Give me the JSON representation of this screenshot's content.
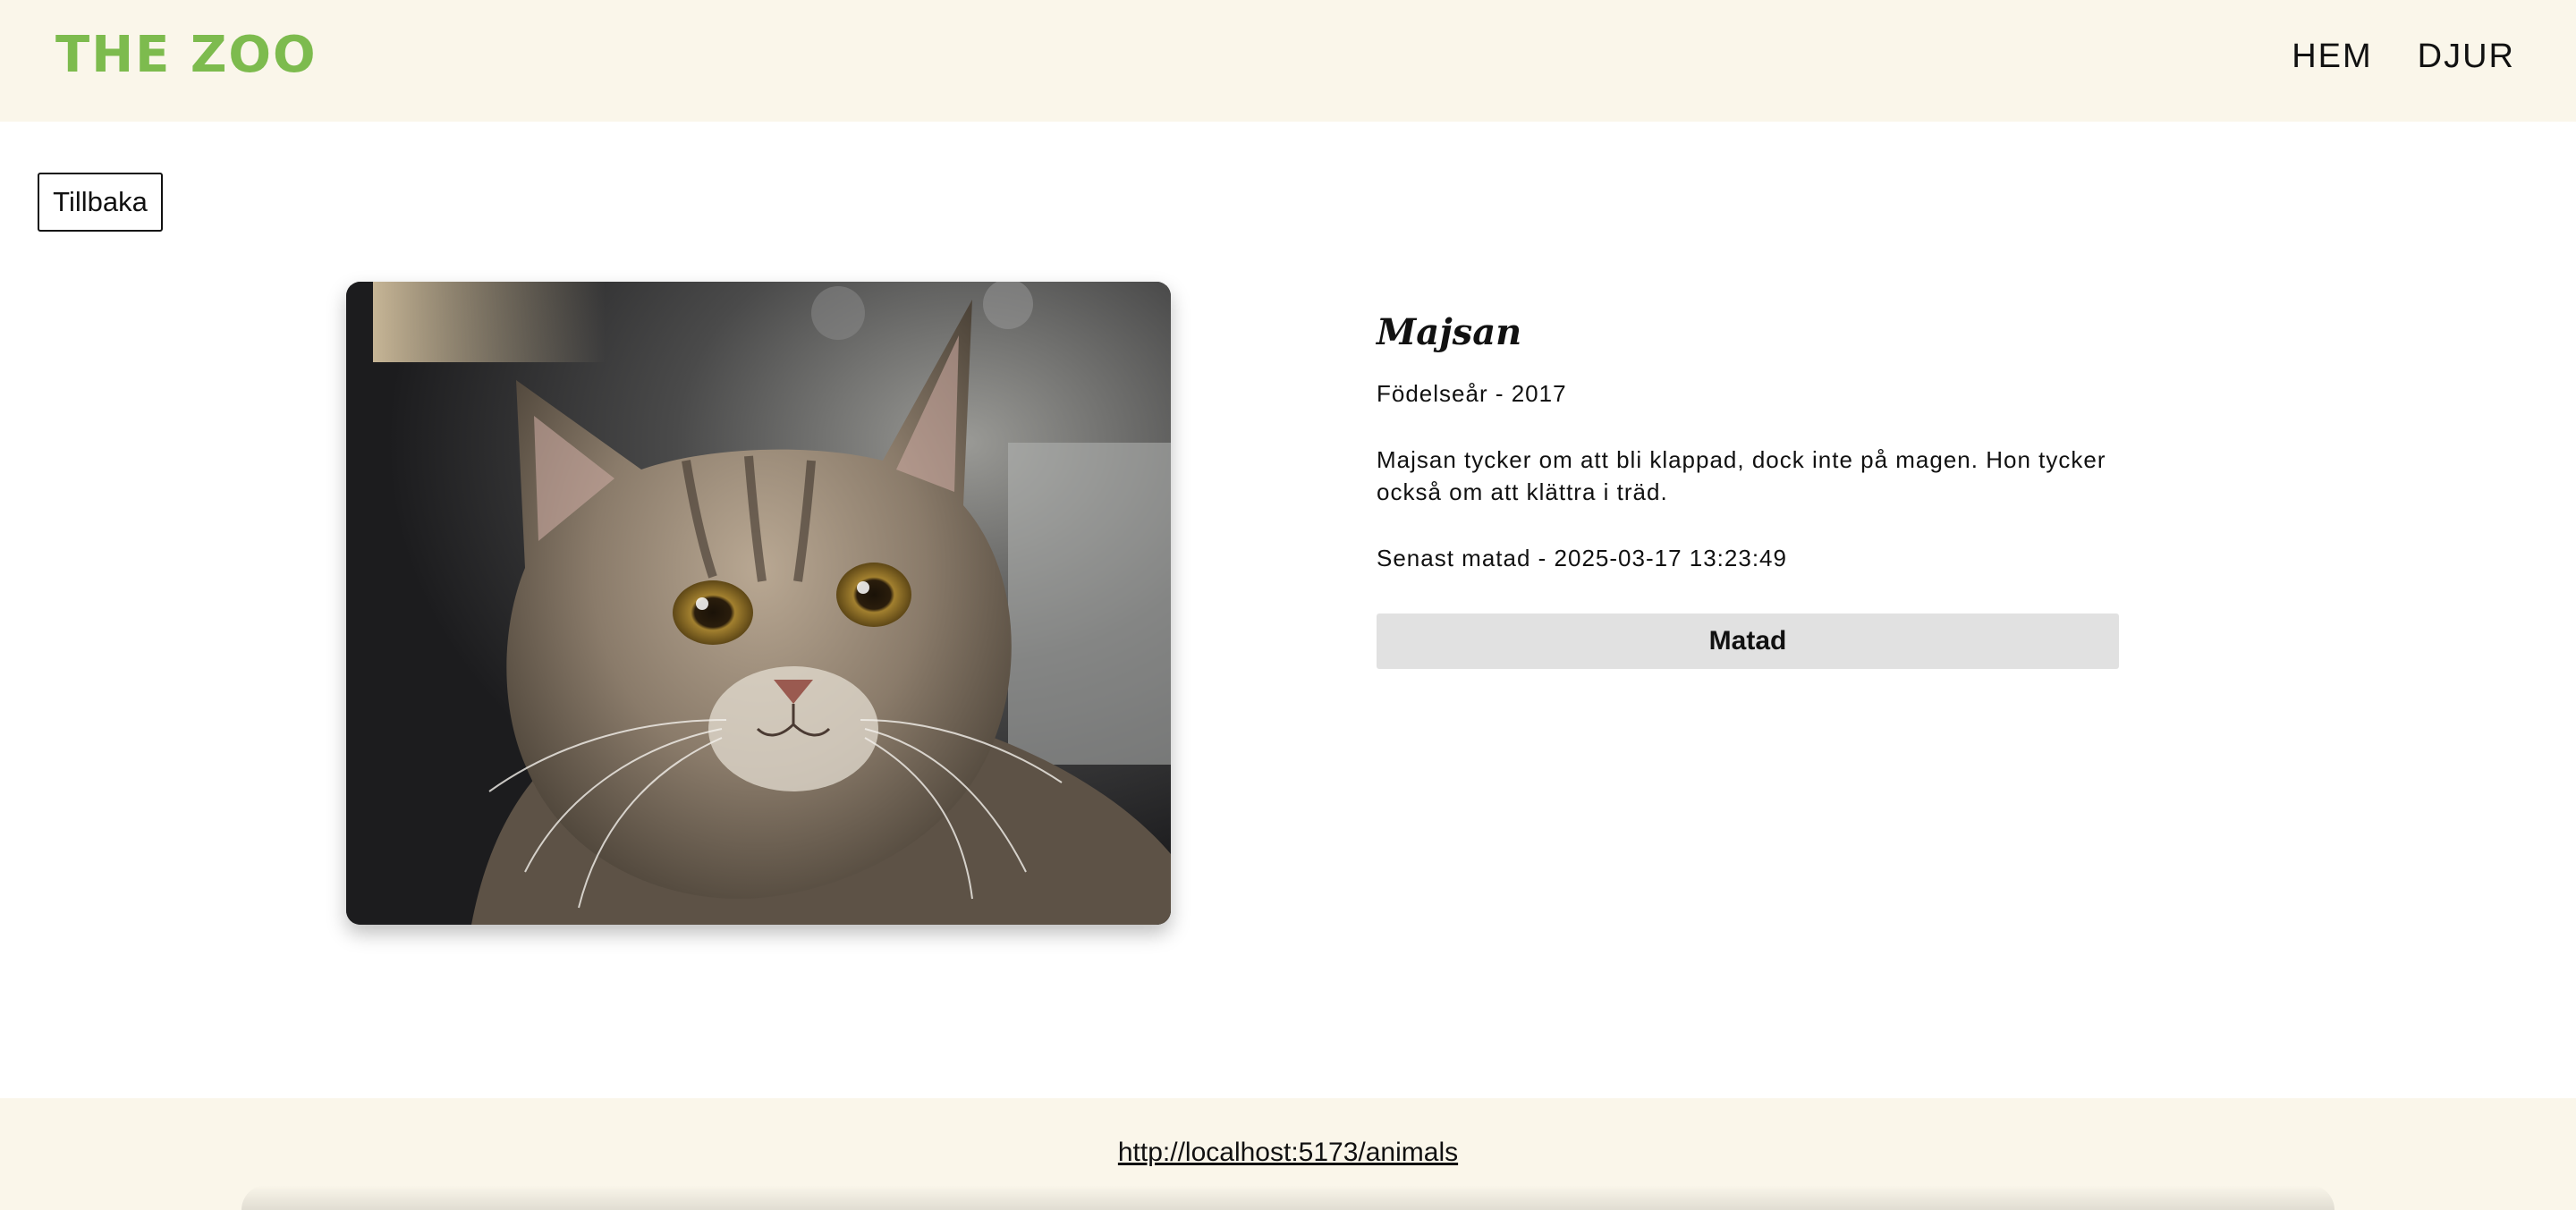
{
  "header": {
    "logo": "THE ZOO",
    "nav": [
      {
        "label": "HEM"
      },
      {
        "label": "DJUR"
      }
    ]
  },
  "back_button": {
    "label": "Tillbaka"
  },
  "animal": {
    "name": "Majsan",
    "birth_year_text": "Födelseår - 2017",
    "description": "Majsan tycker om att bli klappad, dock inte på magen. Hon tycker också om att klättra i träd.",
    "last_fed_text": "Senast matad - 2025-03-17 13:23:49",
    "fed_button_label": "Matad",
    "image_alt": "Majsan"
  },
  "footer": {
    "link_text": "http://localhost:5173/animals"
  },
  "colors": {
    "header_bg": "#faf6ea",
    "logo": "#7dbb4e",
    "fed_button_bg": "#e1e1e1"
  }
}
